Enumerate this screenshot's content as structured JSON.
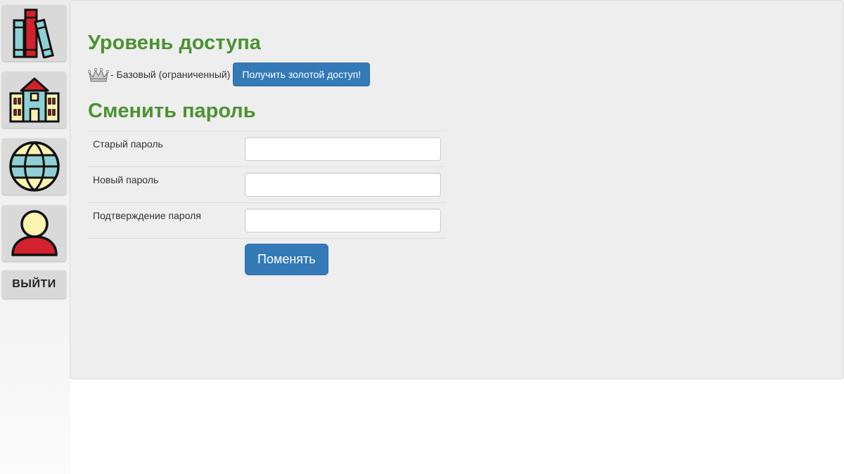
{
  "sidebar": {
    "items": [
      {
        "name": "library",
        "icon": "books-icon"
      },
      {
        "name": "school",
        "icon": "school-building-icon"
      },
      {
        "name": "world",
        "icon": "globe-icon"
      },
      {
        "name": "profile",
        "icon": "user-icon"
      }
    ],
    "logout_label": "ВЫЙТИ"
  },
  "access": {
    "heading": "Уровень доступа",
    "level_text": "- Базовый (ограниченный)",
    "level_icon": "silver-crown-icon",
    "upgrade_button": "Получить золотой доступ!"
  },
  "password": {
    "heading": "Сменить пароль",
    "fields": [
      {
        "label": "Старый пароль",
        "value": "",
        "placeholder": ""
      },
      {
        "label": "Новый пароль",
        "value": "",
        "placeholder": ""
      },
      {
        "label": "Подтверждение пароля",
        "value": "",
        "placeholder": ""
      }
    ],
    "submit_button": "Поменять"
  },
  "colors": {
    "heading_green": "#4b9232",
    "primary_blue": "#337ab7",
    "panel_bg": "#eeeeee",
    "tile_bg": "#d9d9d9"
  }
}
